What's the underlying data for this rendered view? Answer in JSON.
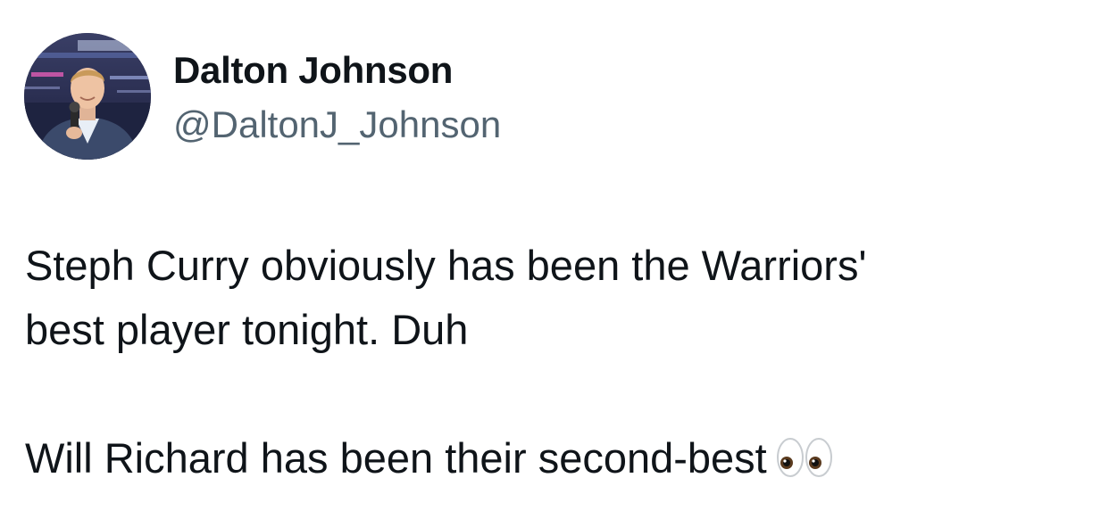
{
  "author": {
    "display_name": "Dalton Johnson",
    "handle": "@DaltonJ_Johnson",
    "avatar_icon": "profile-photo-avatar"
  },
  "tweet": {
    "line_1": "Steph Curry obviously has been the Warriors'",
    "line_2": "best player tonight. Duh",
    "line_3": "Will Richard has been their second-best",
    "emoji": "eyes-emoji-icon"
  },
  "colors": {
    "text": "#0f1419",
    "secondary": "#536471",
    "background": "#ffffff"
  }
}
